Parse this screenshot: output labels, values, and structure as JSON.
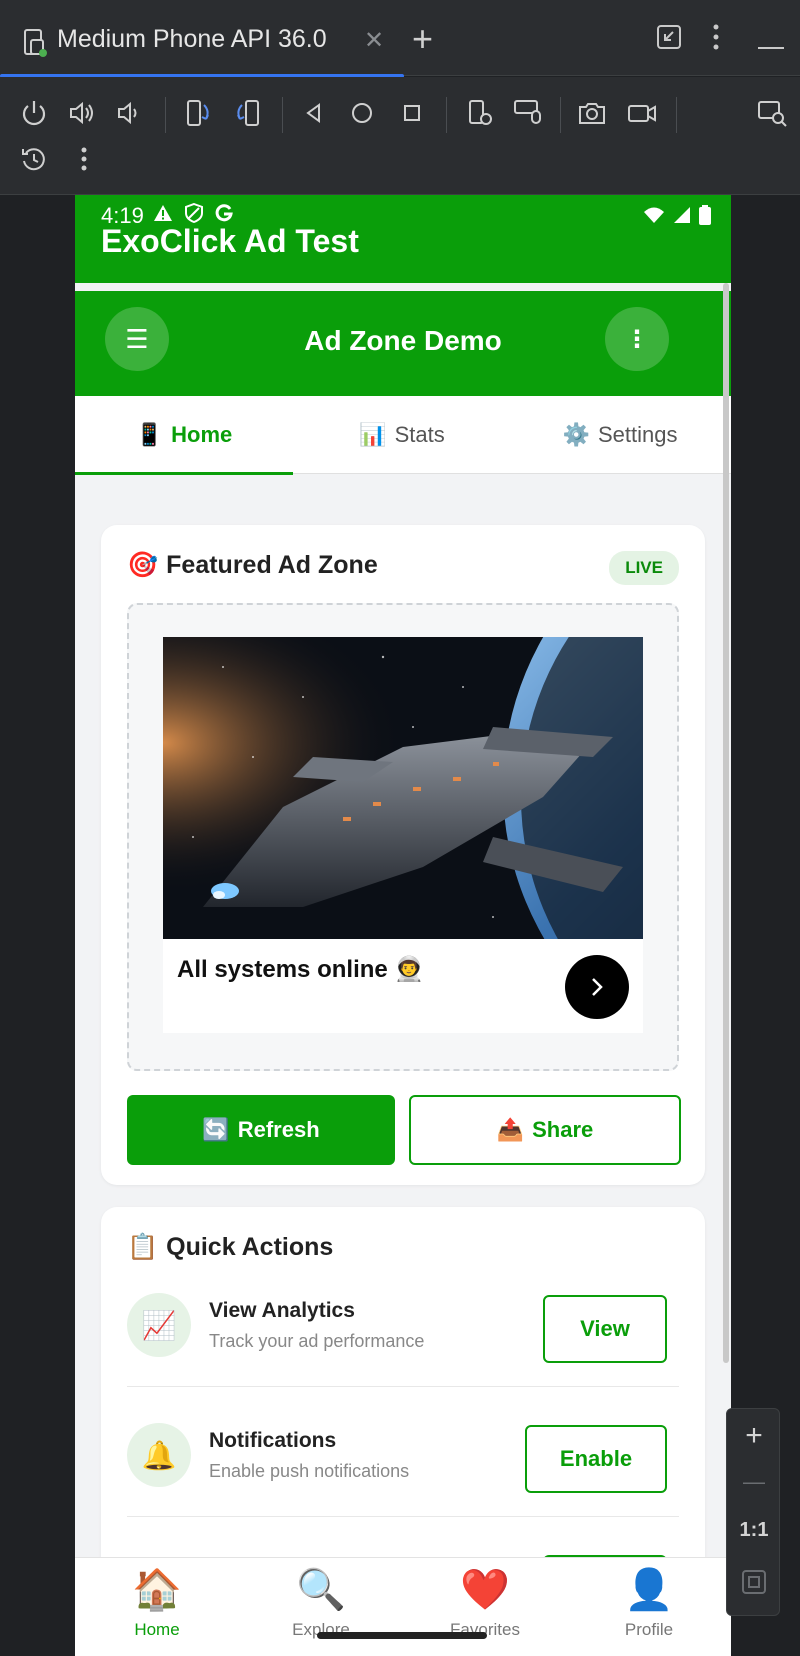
{
  "window": {
    "tab_title": "Medium Phone API 36.0",
    "close_glyph": "✕",
    "add_glyph": "+"
  },
  "status_bar": {
    "time": "4:19"
  },
  "app": {
    "title": "ExoClick Ad Test",
    "appbar_title": "Ad Zone Demo",
    "menu_glyph": "☰",
    "more_glyph": "⋮"
  },
  "tabs": [
    {
      "icon": "📱",
      "label": "Home",
      "active": true
    },
    {
      "icon": "📊",
      "label": "Stats",
      "active": false
    },
    {
      "icon": "⚙️",
      "label": "Settings",
      "active": false
    }
  ],
  "featured": {
    "icon": "🎯",
    "title": "Featured Ad Zone",
    "badge": "LIVE",
    "ad_text": "All systems online 👨‍🚀",
    "refresh_icon": "🔄",
    "refresh_label": "Refresh",
    "share_icon": "📤",
    "share_label": "Share"
  },
  "quick_actions": {
    "icon": "📋",
    "title": "Quick Actions",
    "items": [
      {
        "icon": "📈",
        "title": "View Analytics",
        "subtitle": "Track your ad performance",
        "button": "View"
      },
      {
        "icon": "🔔",
        "title": "Notifications",
        "subtitle": "Enable push notifications",
        "button": "Enable"
      }
    ]
  },
  "bottom_nav": [
    {
      "icon": "🏠",
      "label": "Home",
      "active": true
    },
    {
      "icon": "🔍",
      "label": "Explore",
      "active": false
    },
    {
      "icon": "❤️",
      "label": "Favorites",
      "active": false
    },
    {
      "icon": "👤",
      "label": "Profile",
      "active": false
    }
  ],
  "zoom": {
    "zoom_in": "+",
    "zoom_out": "—",
    "ratio": "1:1"
  },
  "colors": {
    "primary": "#0a9e0a",
    "chrome_bg": "#2b2d30",
    "progress": "#3574f0"
  }
}
